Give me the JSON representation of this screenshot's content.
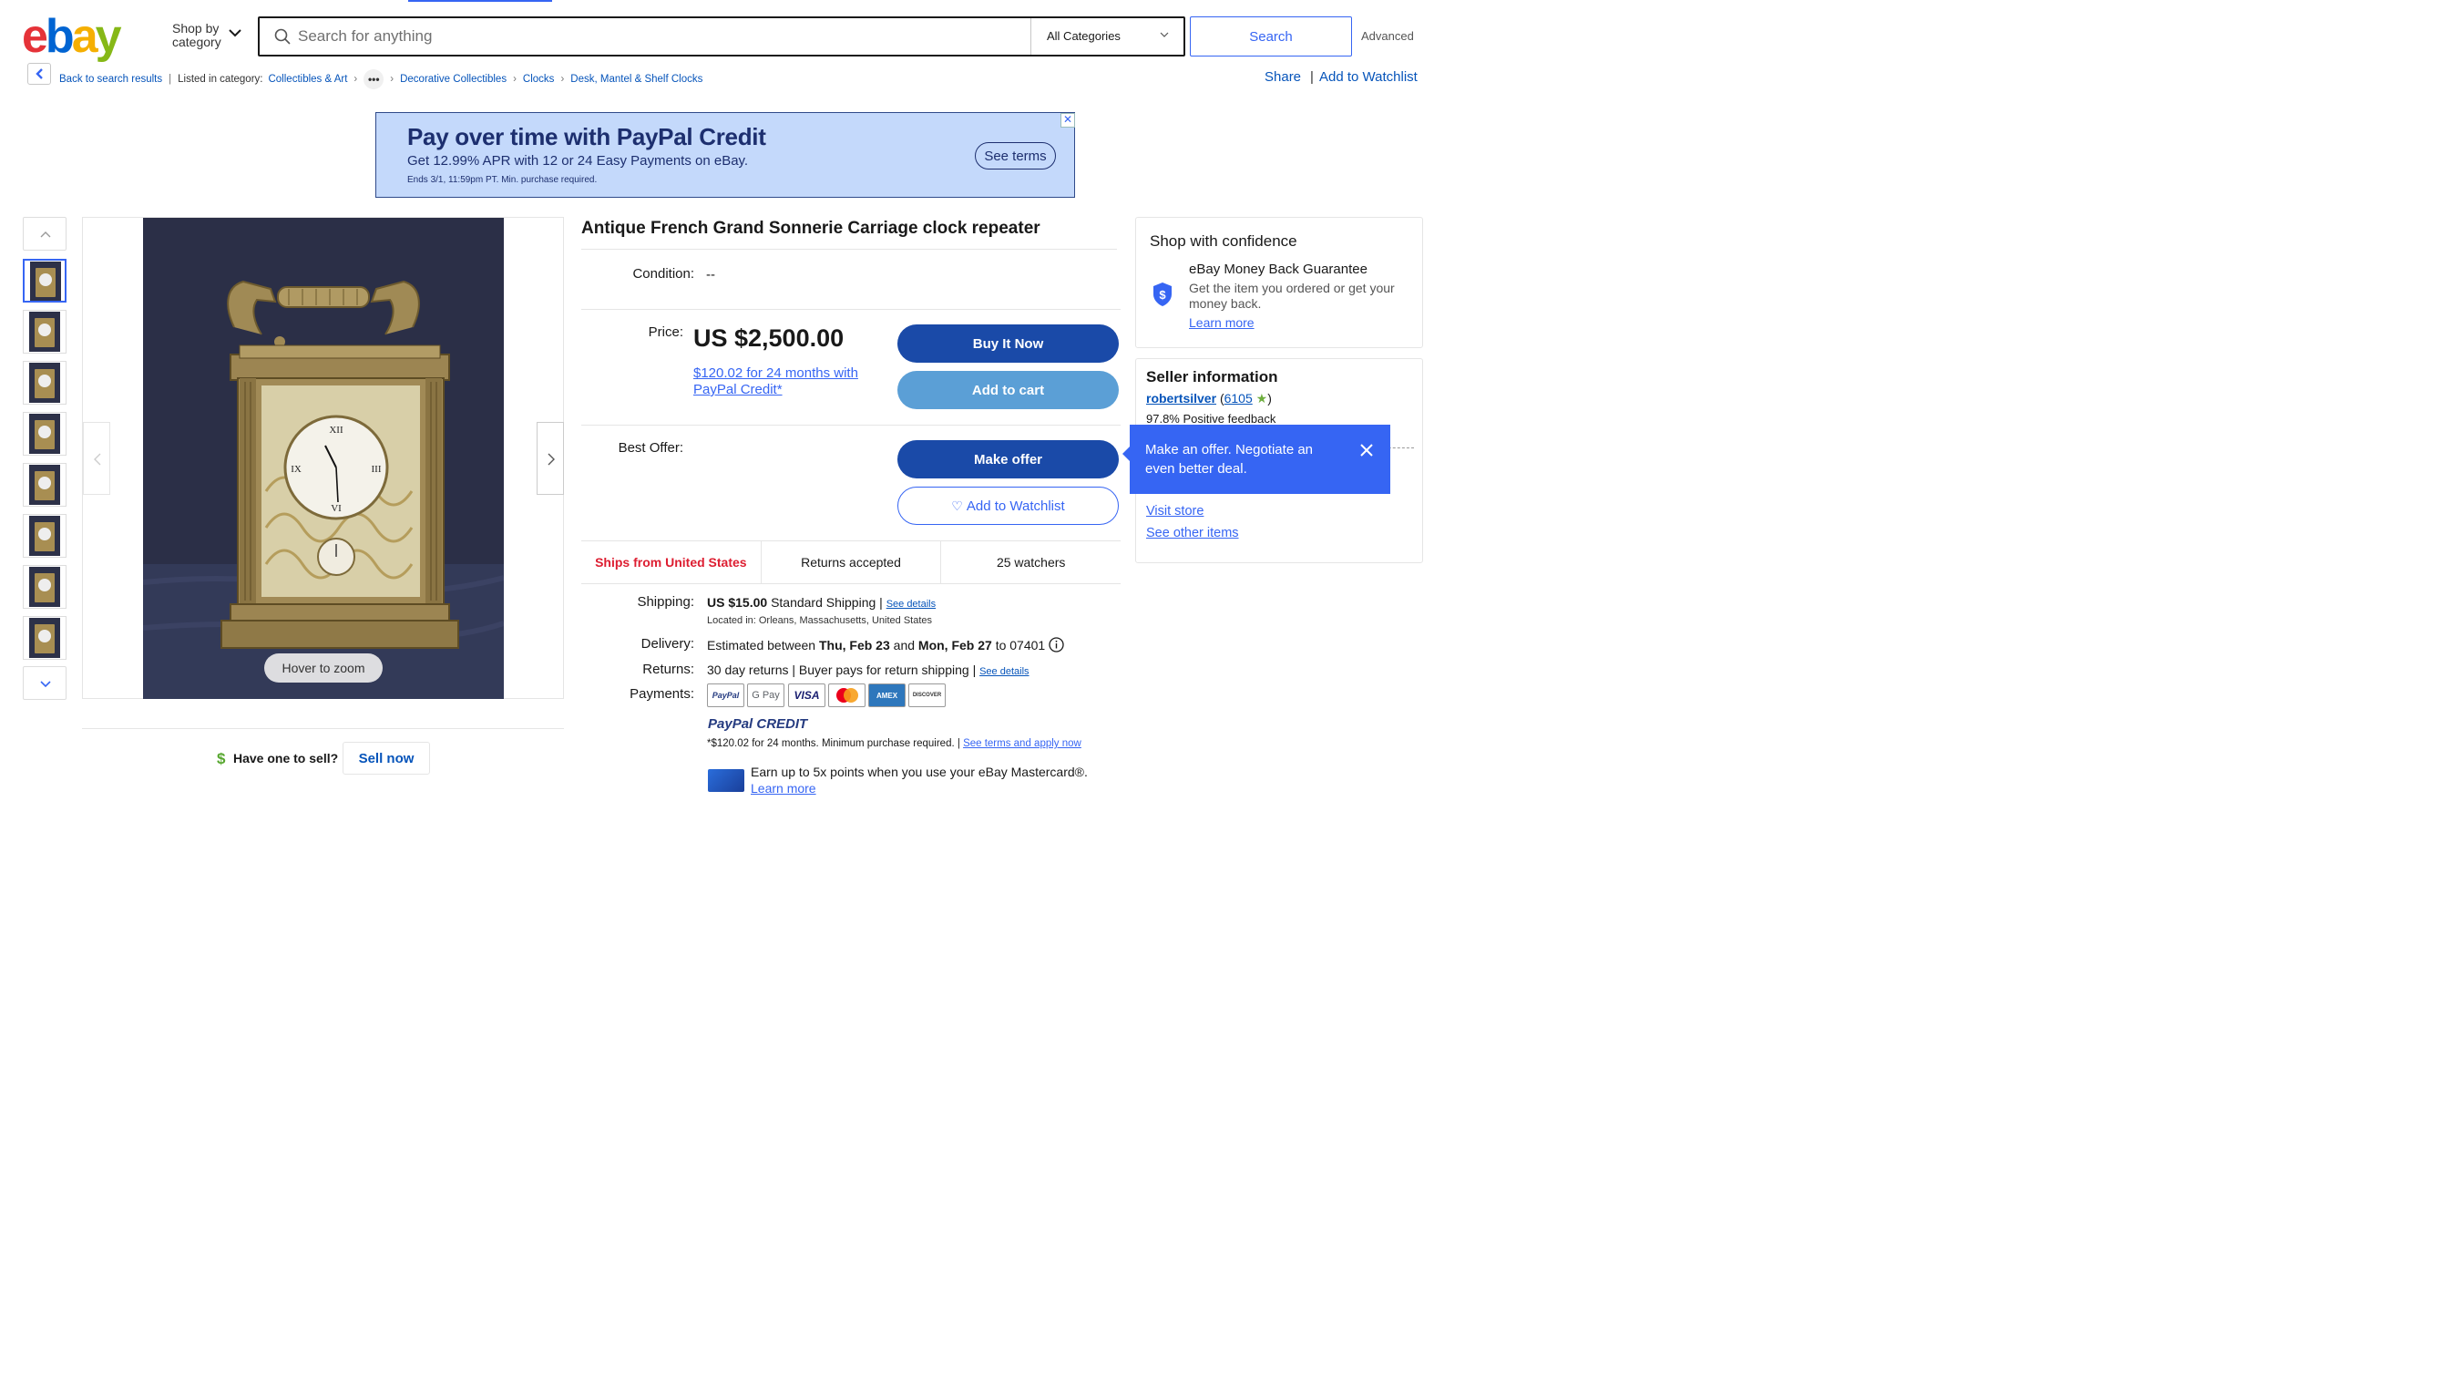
{
  "header": {
    "logo_letters": [
      "e",
      "b",
      "a",
      "y"
    ],
    "logo_colors": [
      "#e53238",
      "#0064d2",
      "#f5af02",
      "#86b817"
    ],
    "shop_by_line1": "Shop by",
    "shop_by_line2": "category",
    "search_placeholder": "Search for anything",
    "category_select": "All Categories",
    "search_button": "Search",
    "advanced": "Advanced"
  },
  "breadcrumb": {
    "back": "Back to search results",
    "listed_in": "Listed in category:",
    "items": [
      "Collectibles & Art",
      "Decorative Collectibles",
      "Clocks",
      "Desk, Mantel & Shelf Clocks"
    ],
    "more": "•••",
    "share": "Share",
    "add_watchlist": "Add to Watchlist"
  },
  "ad": {
    "title": "Pay over time with PayPal Credit",
    "subtitle": "Get 12.99% APR with 12 or 24 Easy Payments on eBay.",
    "fine": "Ends 3/1, 11:59pm PT. Min. purchase required.",
    "terms": "See terms",
    "close": "✕"
  },
  "gallery": {
    "hover_zoom": "Hover to zoom",
    "thumb_count": 8,
    "selected": 0
  },
  "sell": {
    "dollar": "$",
    "question": "Have one to sell?",
    "button": "Sell now"
  },
  "listing": {
    "title": "Antique French Grand Sonnerie Carriage clock repeater",
    "condition_label": "Condition:",
    "condition_value": "--",
    "price_label": "Price:",
    "price": "US $2,500.00",
    "credit_line": "$120.02 for 24 months with PayPal Credit*",
    "buy_now": "Buy It Now",
    "add_to_cart": "Add to cart",
    "best_offer_label": "Best Offer:",
    "make_offer": "Make offer",
    "add_watchlist": "Add to Watchlist",
    "ships_from": "Ships from United States",
    "returns_accepted": "Returns accepted",
    "watchers": "25 watchers",
    "shipping_label": "Shipping:",
    "shipping_price": "US $15.00",
    "shipping_type": "Standard Shipping |",
    "see_details": "See details",
    "located": "Located in: Orleans, Massachusetts, United States",
    "delivery_label": "Delivery:",
    "delivery_prefix": "Estimated between",
    "delivery_start": "Thu, Feb 23",
    "delivery_and": "and",
    "delivery_end": "Mon, Feb 27",
    "delivery_zip": "to 07401",
    "returns_label": "Returns:",
    "returns_text": "30 day returns | Buyer pays for return shipping |",
    "returns_details": "See details",
    "payments_label": "Payments:",
    "payment_methods": [
      "PayPal",
      "G Pay",
      "VISA",
      "Mastercard",
      "AMEX",
      "DISCOVER"
    ],
    "paypal_credit_a": "PayPal",
    "paypal_credit_b": "CREDIT",
    "credit_fine": "*$120.02 for 24 months. Minimum purchase required. |",
    "credit_terms": "See terms and apply now",
    "earn": "Earn up to 5x points when you use your eBay Mastercard®.",
    "earn_learn": "Learn more"
  },
  "confidence": {
    "title": "Shop with confidence",
    "mbg_title": "eBay Money Back Guarantee",
    "mbg_text": "Get the item you ordered or get your money back.",
    "learn_more": "Learn more"
  },
  "seller": {
    "title": "Seller information",
    "name": "robertsilver",
    "score": "6105",
    "feedback": "97.8% Positive feedback",
    "visit_store": "Visit store",
    "other_items": "See other items"
  },
  "tooltip": {
    "text": "Make an offer. Negotiate an even better deal."
  },
  "colors": {
    "primary_blue": "#1a4aa8",
    "link_blue": "#3665f3",
    "ships_red": "#dd1e31"
  }
}
